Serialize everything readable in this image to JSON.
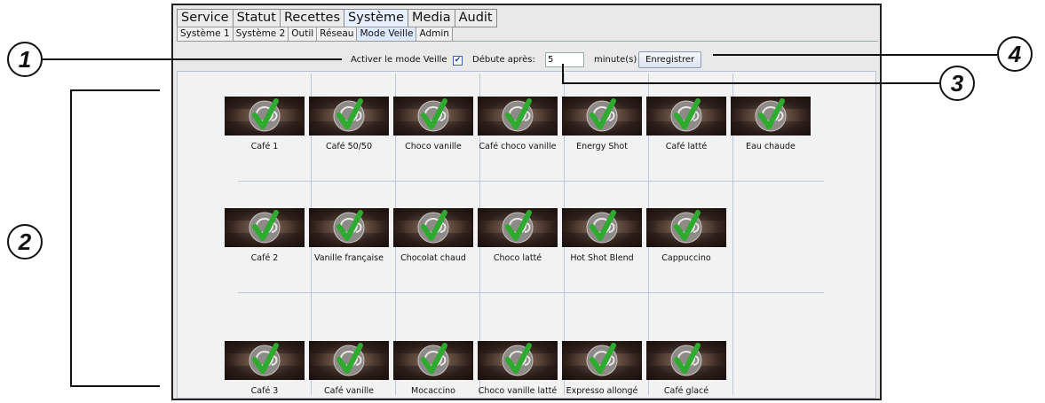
{
  "main_tabs": [
    {
      "label": "Service",
      "active": false
    },
    {
      "label": "Statut",
      "active": false
    },
    {
      "label": "Recettes",
      "active": false
    },
    {
      "label": "Système",
      "active": true
    },
    {
      "label": "Media",
      "active": false
    },
    {
      "label": "Audit",
      "active": false
    }
  ],
  "sub_tabs": [
    {
      "label": "Système 1",
      "active": false
    },
    {
      "label": "Système 2",
      "active": false
    },
    {
      "label": "Outil",
      "active": false
    },
    {
      "label": "Réseau",
      "active": false
    },
    {
      "label": "Mode Veille",
      "active": true
    },
    {
      "label": "Admin",
      "active": false
    }
  ],
  "sleep_bar": {
    "enable_label": "Activer le mode Veille",
    "enable_checked": true,
    "check_glyph": "✔",
    "start_label": "Débute après:",
    "delay_value": "5",
    "unit_label": "minute(s)",
    "save_label": "Enregistrer"
  },
  "recipes": [
    [
      "Café 1",
      "Café 50/50",
      "Choco vanille",
      "Café choco vanille",
      "Energy Shot",
      "Café latté",
      "Eau chaude"
    ],
    [
      "Café 2",
      "Vanille française",
      "Chocolat chaud",
      "Choco latté",
      "Hot Shot Blend",
      "Cappuccino"
    ],
    [
      "Café 3",
      "Café vanille",
      "Mocaccino",
      "Choco vanille latté",
      "Expresso allongé",
      "Café glacé"
    ]
  ],
  "recipe_icon": "cup-with-green-check-icon",
  "colors": {
    "check_green": "#2eaa2e",
    "active_tab": "#e6f0ff",
    "grid_lines": "#b9c6dc"
  },
  "callouts": [
    "1",
    "2",
    "3",
    "4"
  ]
}
